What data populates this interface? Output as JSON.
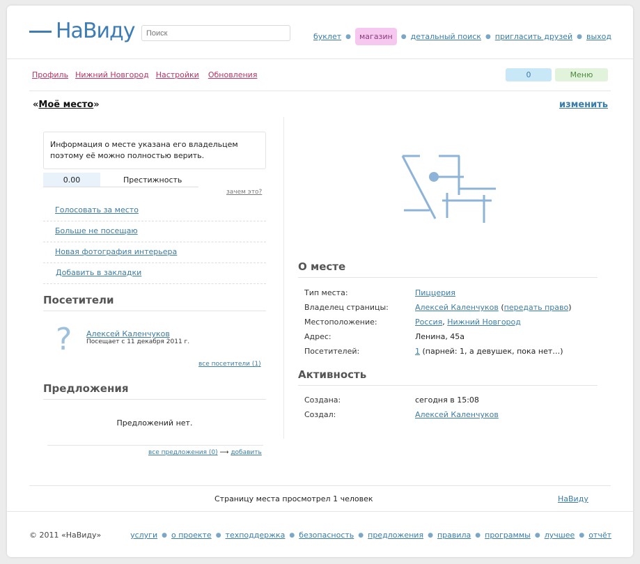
{
  "header": {
    "logo": "НаВиду",
    "search_placeholder": "Поиск",
    "nav": [
      {
        "label": "буклет"
      },
      {
        "label": "магазин"
      },
      {
        "label": "детальный поиск"
      },
      {
        "label": "пригласить друзей"
      },
      {
        "label": "выход"
      }
    ],
    "separator": "●"
  },
  "subnav": {
    "items": [
      "Профиль",
      "Нижний Новгород",
      "Настройки",
      "Обновления"
    ],
    "counter": "0",
    "menu": "Меню"
  },
  "title": {
    "open_quote": "«",
    "name": "Моё место",
    "close_quote": "»",
    "edit": "изменить"
  },
  "left": {
    "info": "Информация о месте указана его владельцем поэтому её можно полностью верить.",
    "prestige_value": "0.00",
    "prestige_label": "Престижность",
    "why": "зачем это?",
    "actions": [
      "Голосовать за место",
      "Больше не посещаю",
      "Новая фотография интерьера",
      "Добавить в закладки"
    ],
    "visitors_heading": "Посетители",
    "avatar_glyph": "?",
    "visitor_name": "Алексей Каленчуков",
    "visitor_since": "Посещает с 11 декабря 2011 г.",
    "all_visitors": "все посетители (1)",
    "offers_heading": "Предложения",
    "no_offers": "Предложений нет.",
    "all_offers": "все предложения (0)",
    "arrow": "⟶",
    "add": "добавить"
  },
  "about": {
    "heading": "О месте",
    "type_label": "Тип места:",
    "type_value": "Пиццерия",
    "owner_label": "Владелец страницы:",
    "owner_value": "Алексей Каленчуков",
    "transfer": "передать право",
    "location_label": "Местоположение:",
    "country": "Россия",
    "city": "Нижний Новгород",
    "address_label": "Адрес:",
    "address_value": "Ленина, 45а",
    "visitors_label": "Посетителей:",
    "visitors_count": "1",
    "visitors_note": "(парней: 1, а девушек, пока нет…)"
  },
  "activity": {
    "heading": "Активность",
    "created_label": "Создана:",
    "created_value": "сегодня в 15:08",
    "creator_label": "Создал:",
    "creator_value": "Алексей Каленчуков"
  },
  "bottom": {
    "views": "Страницу места просмотрел 1 человек",
    "navidu": "НаВиду"
  },
  "footer": {
    "copyright": "© 2011 «НаВиду»",
    "links": [
      "услуги",
      "о проекте",
      "техподдержка",
      "безопасность",
      "предложения",
      "правила",
      "программы",
      "лучшее",
      "отчёт"
    ]
  },
  "colors": {
    "accent": "#3d7cb5",
    "link": "#3a7ca8",
    "profile_links": "#c0305f",
    "shop_bg": "#f6c8ef"
  }
}
